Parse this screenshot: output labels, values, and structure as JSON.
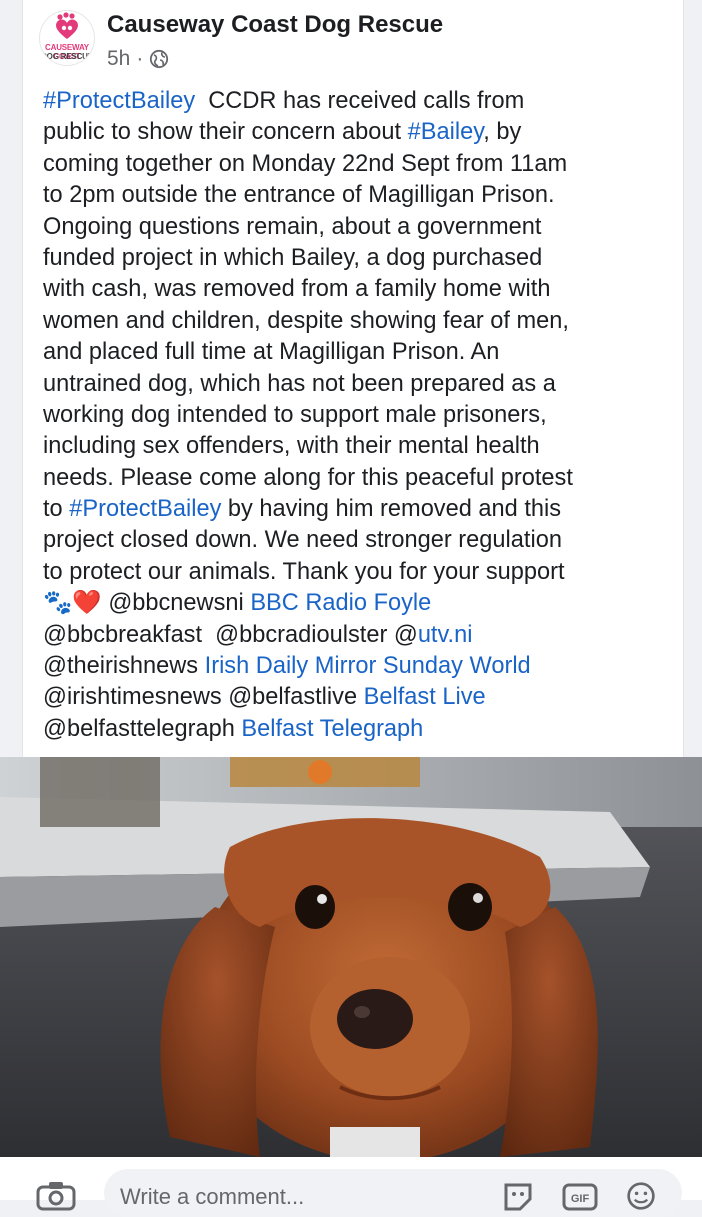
{
  "post": {
    "page_name": "Causeway Coast Dog Rescue",
    "time": "5h",
    "separator": "·",
    "privacy_icon": "globe-icon",
    "avatar": {
      "line1": "CAUSEWAY COAST",
      "line2": "DOG RESCUE",
      "icon": "paw-heart-logo"
    },
    "text": {
      "l1": {
        "tag": "#ProtectBailey",
        "rest": "  CCDR has received calls from"
      },
      "l2": {
        "pre": "public to show their concern about ",
        "tag": "#Bailey",
        "post": ", by"
      },
      "l3": "coming together on Monday 22nd Sept from 11am",
      "l4": "to 2pm outside the entrance of Magilligan Prison.",
      "l5": "Ongoing questions remain, about a government",
      "l6": "funded project in which Bailey, a dog purchased",
      "l7": "with cash, was removed from a family home with",
      "l8": "women and children, despite showing fear of men,",
      "l9": "and placed full time at Magilligan Prison. An",
      "l10": "untrained dog, which has not been prepared as a",
      "l11": "working dog intended to support male prisoners,",
      "l12": "including sex offenders, with their mental health",
      "l13": "needs. Please come along for this peaceful protest",
      "l14": {
        "pre": "to ",
        "tag": "#ProtectBailey",
        "post": " by having him removed and this"
      },
      "l15": "project closed down. We need stronger regulation",
      "l16": "to protect our animals. Thank you for your support",
      "l17": {
        "emoji": "🐾❤️",
        "mention": " @bbcnewsni ",
        "link": "BBC Radio Foyle"
      },
      "l18": {
        "mentions": "@bbcbreakfast  @bbcradioulster @",
        "link": "utv.ni"
      },
      "l19": {
        "mention": "@theirishnews ",
        "link": "Irish Daily Mirror Sunday World"
      },
      "l20": {
        "mention": "@irishtimesnews @belfastlive ",
        "link": "Belfast Live"
      },
      "l21": {
        "mention": "@belfasttelegraph ",
        "link": "Belfast Telegraph"
      }
    },
    "photo": {
      "subject": "red cocker spaniel puppy"
    }
  },
  "comment_bar": {
    "placeholder": "Write a comment...",
    "icons": [
      "camera-icon",
      "sticker-icon",
      "gif-icon",
      "emoji-icon"
    ]
  },
  "colors": {
    "link": "#1a64c8",
    "text": "#1c1e21",
    "meta": "#65676b",
    "logo_pink": "#e23a7a"
  }
}
